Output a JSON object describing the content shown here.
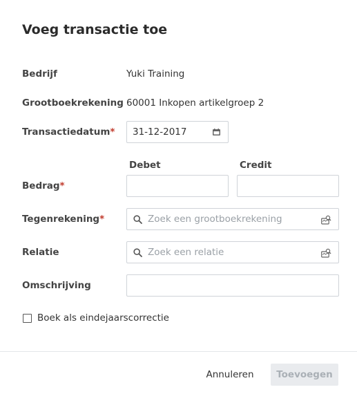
{
  "dialog": {
    "title": "Voeg transactie toe",
    "required_marker": "*"
  },
  "fields": {
    "company": {
      "label": "Bedrijf",
      "value": "Yuki Training"
    },
    "ledger": {
      "label": "Grootboekrekening",
      "value": "60001 Inkopen artikelgroep 2"
    },
    "date": {
      "label": "Transactiedatum",
      "value": "31-12-2017",
      "icon": "calendar-icon"
    },
    "amount": {
      "label": "Bedrag",
      "debit_header": "Debet",
      "credit_header": "Credit",
      "debit_value": "",
      "credit_value": ""
    },
    "contra_account": {
      "label": "Tegenrekening",
      "placeholder": "Zoek een grootboekrekening",
      "icons": [
        "search-icon",
        "lookup-icon"
      ]
    },
    "relation": {
      "label": "Relatie",
      "placeholder": "Zoek een relatie",
      "icons": [
        "search-icon",
        "lookup-icon"
      ]
    },
    "description": {
      "label": "Omschrijving",
      "value": ""
    }
  },
  "year_end": {
    "label": "Boek als eindejaarscorrectie",
    "checked": false
  },
  "footer": {
    "cancel_label": "Annuleren",
    "add_label": "Toevoegen",
    "add_enabled": false
  },
  "colors": {
    "required": "#c0392b",
    "border": "#cfd3d8",
    "disabled_button_bg": "#e9ebee",
    "disabled_button_text": "#aab0b6",
    "placeholder": "#9aa0a6"
  }
}
